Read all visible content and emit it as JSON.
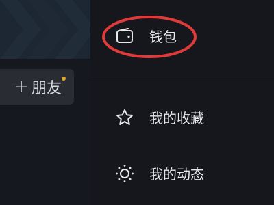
{
  "left_panel": {
    "friend_button": {
      "plus_icon": "plus-icon",
      "label": "朋友",
      "badge_color": "#e0a82e"
    }
  },
  "drawer": {
    "items": [
      {
        "label": "钱包",
        "icon": "wallet-icon"
      },
      {
        "label": "我的收藏",
        "icon": "star-icon"
      },
      {
        "label": "我的动态",
        "icon": "sun-icon"
      }
    ]
  },
  "annotation": {
    "shape": "ellipse",
    "color": "#e03a3a"
  }
}
